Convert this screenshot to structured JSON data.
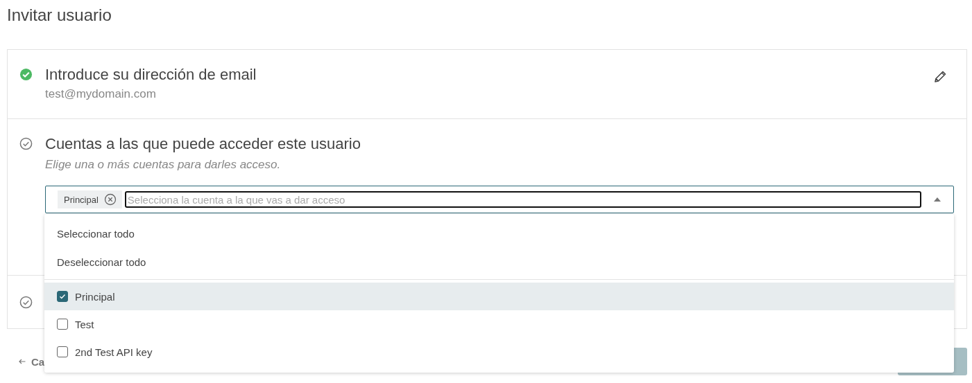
{
  "page_title": "Invitar usuario",
  "steps": [
    {
      "done": true,
      "title": "Introduce su dirección de email",
      "value": "test@mydomain.com",
      "editable": true
    },
    {
      "done": false,
      "title": "Cuentas a las que puede acceder este usuario",
      "hint": "Elige una o más cuentas para darles acceso.",
      "select": {
        "chips": [
          "Principal"
        ],
        "placeholder": "Selecciona la cuenta a la que vas a dar acceso",
        "expanded": true,
        "actions": [
          "Seleccionar todo",
          "Deseleccionar todo"
        ],
        "options": [
          {
            "label": "Principal",
            "checked": true,
            "selected": true
          },
          {
            "label": "Test",
            "checked": false,
            "selected": false
          },
          {
            "label": "2nd Test API key",
            "checked": false,
            "selected": false
          }
        ]
      }
    },
    {
      "done": false
    }
  ],
  "back_link": "Ca"
}
